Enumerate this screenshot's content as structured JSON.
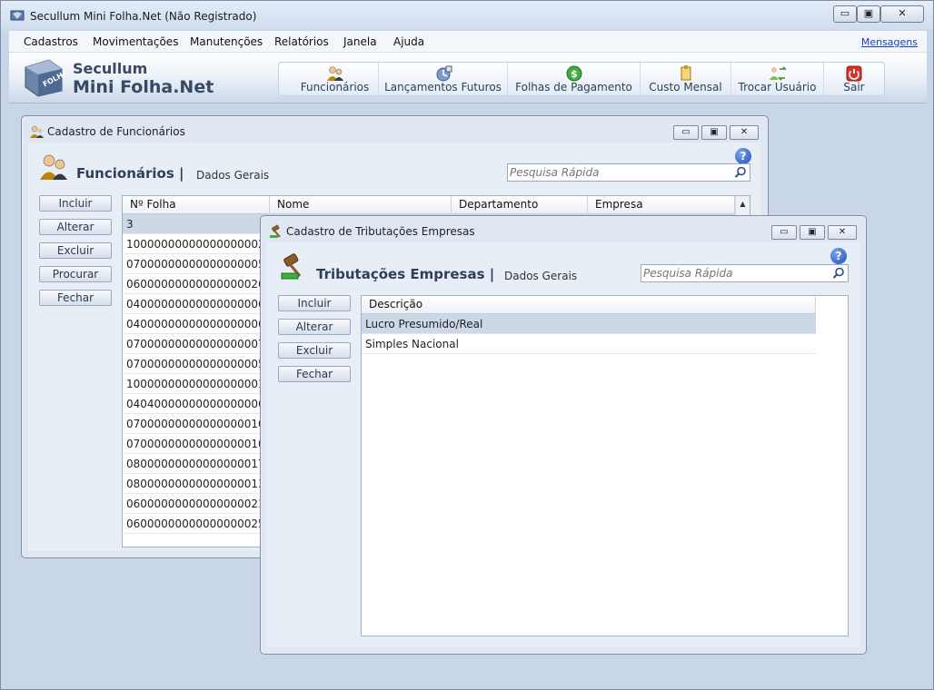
{
  "window": {
    "title": "Secullum Mini Folha.Net (Não Registrado)",
    "minimize": "▭",
    "maximize": "▣",
    "close": "✕"
  },
  "menu": {
    "items": [
      "Cadastros",
      "Movimentações",
      "Manutenções",
      "Relatórios",
      "Janela",
      "Ajuda"
    ],
    "messages_link": "Mensagens"
  },
  "brand": {
    "line1": "Secullum",
    "line2": "Mini Folha.Net",
    "logo_text": "FOLHA"
  },
  "toolbar": {
    "buttons": [
      {
        "label": "Funcionários",
        "icon": "employees-icon"
      },
      {
        "label": "Lançamentos Futuros",
        "icon": "future-entries-icon"
      },
      {
        "label": "Folhas de Pagamento",
        "icon": "payroll-dollar-icon"
      },
      {
        "label": "Custo Mensal",
        "icon": "monthly-cost-icon"
      },
      {
        "label": "Trocar Usuário",
        "icon": "switch-user-icon"
      },
      {
        "label": "Sair",
        "icon": "power-icon"
      }
    ]
  },
  "employees_window": {
    "title": "Cadastro de Funcionários",
    "section_title": "Funcionários |",
    "section_sub": "Dados Gerais",
    "search_placeholder": "Pesquisa Rápida",
    "buttons": [
      "Incluir",
      "Alterar",
      "Excluir",
      "Procurar",
      "Fechar"
    ],
    "columns": [
      "Nº Folha",
      "Nome",
      "Departamento",
      "Empresa"
    ],
    "rows": [
      "3",
      "10000000000000000002",
      "07000000000000000005",
      "06000000000000000026",
      "04000000000000000006",
      "04000000000000000006",
      "07000000000000000007",
      "07000000000000000005",
      "10000000000000000001",
      "04040000000000000006",
      "07000000000000000010",
      "07000000000000000010",
      "08000000000000000017",
      "08000000000000000013",
      "06000000000000000021",
      "06000000000000000025"
    ]
  },
  "tributacoes_window": {
    "title": "Cadastro de Tributações Empresas",
    "section_title": "Tributações Empresas |",
    "section_sub": "Dados Gerais",
    "search_placeholder": "Pesquisa Rápida",
    "buttons": [
      "Incluir",
      "Alterar",
      "Excluir",
      "Fechar"
    ],
    "columns": [
      "Descrição"
    ],
    "rows": [
      "Lucro Presumido/Real",
      "Simples Nacional"
    ]
  },
  "help": "?"
}
